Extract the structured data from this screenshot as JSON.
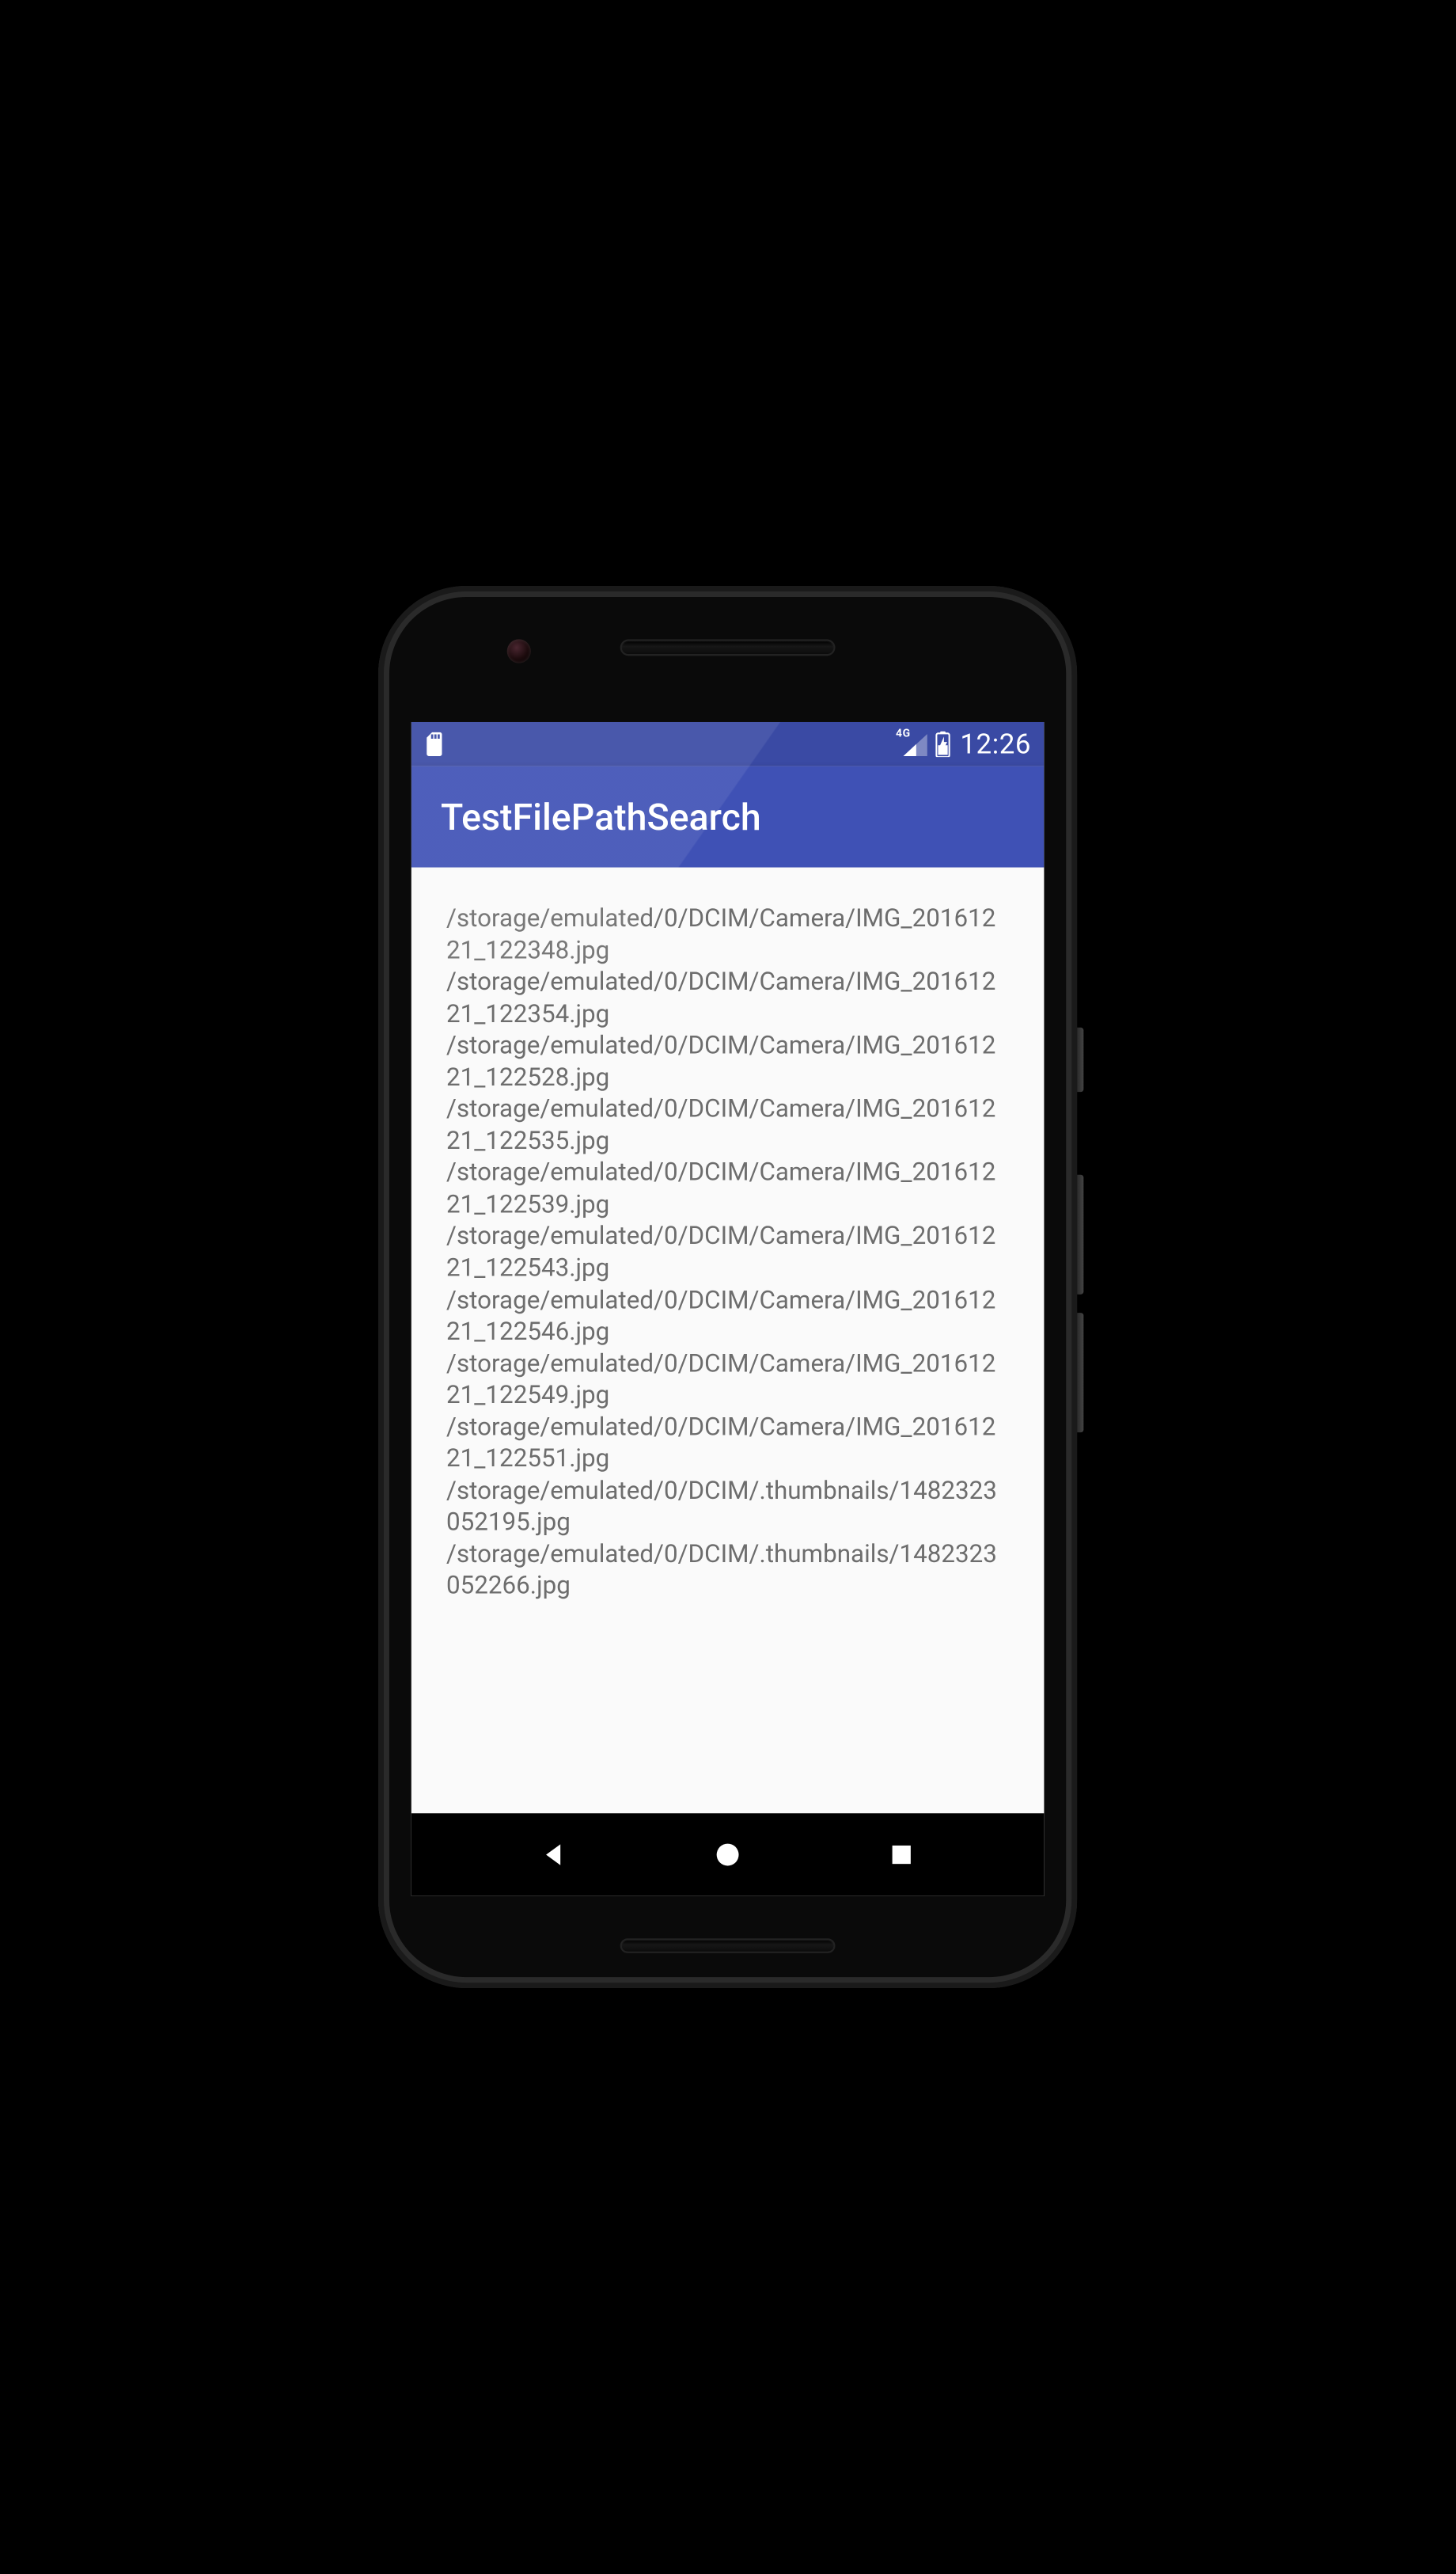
{
  "status_bar": {
    "time": "12:26",
    "network_label": "4G",
    "icons": {
      "sd": "sd-card-icon",
      "signal": "signal-icon",
      "battery": "battery-charging-icon"
    }
  },
  "app_bar": {
    "title": "TestFilePathSearch"
  },
  "content": {
    "paths": [
      "/storage/emulated/0/DCIM/Camera/IMG_20161221_122348.jpg",
      "/storage/emulated/0/DCIM/Camera/IMG_20161221_122354.jpg",
      "/storage/emulated/0/DCIM/Camera/IMG_20161221_122528.jpg",
      "/storage/emulated/0/DCIM/Camera/IMG_20161221_122535.jpg",
      "/storage/emulated/0/DCIM/Camera/IMG_20161221_122539.jpg",
      "/storage/emulated/0/DCIM/Camera/IMG_20161221_122543.jpg",
      "/storage/emulated/0/DCIM/Camera/IMG_20161221_122546.jpg",
      "/storage/emulated/0/DCIM/Camera/IMG_20161221_122549.jpg",
      "/storage/emulated/0/DCIM/Camera/IMG_20161221_122551.jpg",
      "/storage/emulated/0/DCIM/.thumbnails/1482323052195.jpg",
      "/storage/emulated/0/DCIM/.thumbnails/1482323052266.jpg"
    ]
  },
  "nav_bar": {
    "buttons": [
      "back",
      "home",
      "overview"
    ]
  }
}
